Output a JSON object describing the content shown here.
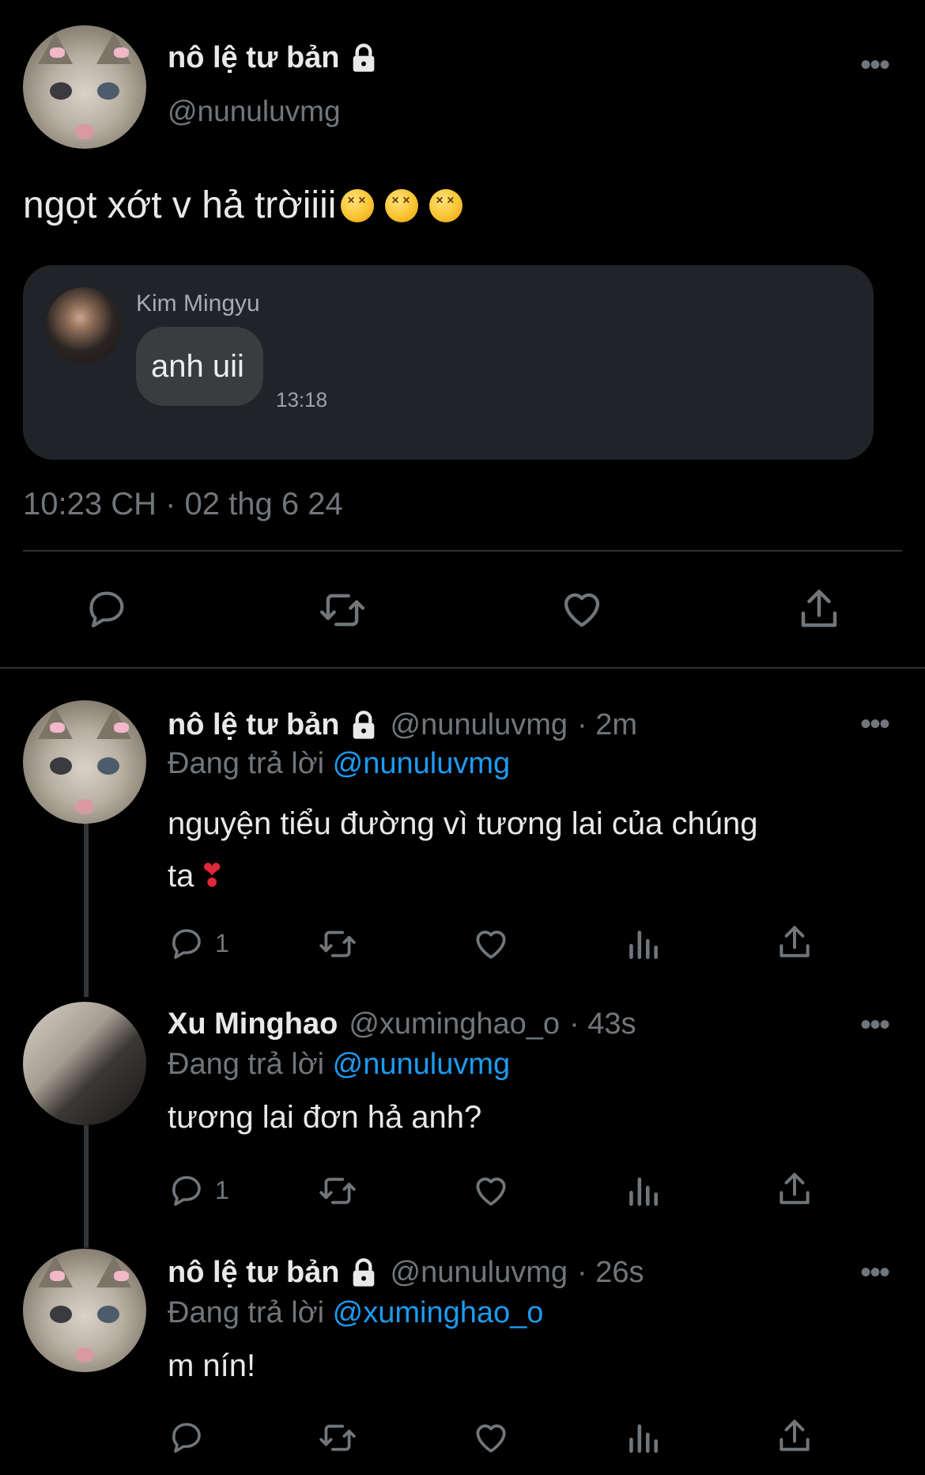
{
  "main_tweet": {
    "display_name": "nô lệ tư bản",
    "handle": "@nunuluvmg",
    "text": "ngọt xớt v hả trờiiii",
    "emoji": [
      "confounded-face",
      "confounded-face",
      "confounded-face"
    ],
    "quoted_card": {
      "sender": "Kim Mingyu",
      "message": "anh uii",
      "time": "13:18"
    },
    "timestamp": "10:23 CH · 02 thg 6 24"
  },
  "replies": [
    {
      "display_name": "nô lệ tư bản",
      "locked": true,
      "handle": "@nunuluvmg",
      "time": "· 2m",
      "replying_label": "Đang trả lời",
      "replying_to": "@nunuluvmg",
      "text_line1": "nguyện tiểu đường vì tương lai của chúng",
      "text_line2": "ta",
      "text_emoji": "❣",
      "reply_count": "1"
    },
    {
      "display_name": "Xu Minghao",
      "locked": false,
      "handle": "@xuminghao_o",
      "time": "· 43s",
      "replying_label": "Đang trả lời",
      "replying_to": "@nunuluvmg",
      "text_line1": "tương lai đơn hả anh?",
      "reply_count": "1"
    },
    {
      "display_name": "nô lệ tư bản",
      "locked": true,
      "handle": "@nunuluvmg",
      "time": "· 26s",
      "replying_label": "Đang trả lời",
      "replying_to": "@xuminghao_o",
      "text_line1": "m nín!",
      "reply_count": ""
    }
  ],
  "colors": {
    "background": "#000000",
    "text": "#e7e9ea",
    "muted": "#71767b",
    "link": "#1d9bf0",
    "card": "#202327"
  }
}
